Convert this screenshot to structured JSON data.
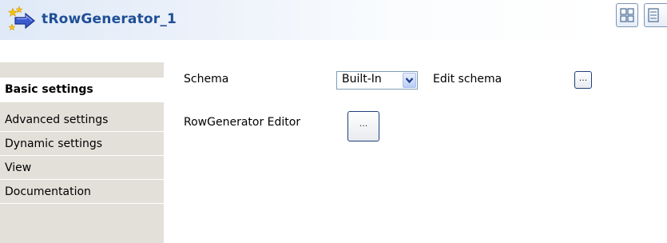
{
  "header": {
    "component_name": "tRowGenerator_1",
    "component_icon": "row-generator-icon"
  },
  "toolbar": {
    "layout_buttons": [
      "layout-grid-icon",
      "layout-list-icon"
    ]
  },
  "tabs": [
    {
      "label": "Basic settings",
      "selected": true
    },
    {
      "label": "Advanced settings",
      "selected": false
    },
    {
      "label": "Dynamic settings",
      "selected": false
    },
    {
      "label": "View",
      "selected": false
    },
    {
      "label": "Documentation",
      "selected": false
    }
  ],
  "basic": {
    "schema_label": "Schema",
    "schema_value": "Built-In",
    "edit_schema_label": "Edit schema",
    "edit_schema_button": "...",
    "row_generator_label": "RowGenerator Editor",
    "row_generator_button": "..."
  },
  "colors": {
    "title": "#1f4f96",
    "tab_background": "#e2e0d8",
    "header_gradient_start": "#dfe9f7"
  }
}
